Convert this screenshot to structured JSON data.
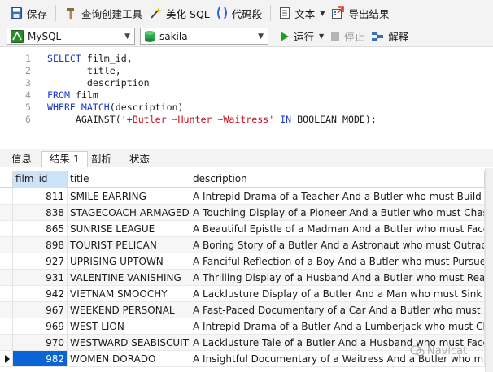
{
  "toolbar": {
    "save": "保存",
    "query_builder": "查询创建工具",
    "beautify": "美化 SQL",
    "snippet": "代码段",
    "text": "文本",
    "export": "导出结果"
  },
  "connection": {
    "server": "MySQL",
    "database": "sakila",
    "run": "运行",
    "stop": "停止",
    "explain": "解释"
  },
  "editor": {
    "lines": [
      {
        "n": "1",
        "parts": [
          {
            "t": "SELECT",
            "c": "kw"
          },
          {
            "t": " film_id,",
            "c": "plain"
          }
        ]
      },
      {
        "n": "2",
        "parts": [
          {
            "t": "       title,",
            "c": "plain"
          }
        ]
      },
      {
        "n": "3",
        "parts": [
          {
            "t": "       description",
            "c": "plain"
          }
        ]
      },
      {
        "n": "4",
        "parts": [
          {
            "t": "FROM",
            "c": "kw"
          },
          {
            "t": " film",
            "c": "plain"
          }
        ]
      },
      {
        "n": "5",
        "parts": [
          {
            "t": "WHERE MATCH",
            "c": "kw"
          },
          {
            "t": "(description)",
            "c": "plain"
          }
        ]
      },
      {
        "n": "6",
        "parts": [
          {
            "t": "     AGAINST(",
            "c": "plain"
          },
          {
            "t": "'+Butler ~Hunter ~Waitress'",
            "c": "str"
          },
          {
            "t": " ",
            "c": "plain"
          },
          {
            "t": "IN",
            "c": "kw"
          },
          {
            "t": " BOOLEAN MODE);",
            "c": "plain"
          }
        ]
      }
    ]
  },
  "tabs": [
    {
      "label": "信息"
    },
    {
      "label": "结果 1"
    },
    {
      "label": "剖析"
    },
    {
      "label": "状态"
    }
  ],
  "grid": {
    "columns": [
      "film_id",
      "title",
      "description"
    ],
    "rows": [
      {
        "film_id": "811",
        "title": "SMILE EARRING",
        "description": "A Intrepid Drama of a Teacher And a Butler who must Build a Pastry"
      },
      {
        "film_id": "838",
        "title": "STAGECOACH ARMAGEDDON",
        "description": "A Touching Display of a Pioneer And a Butler who must Chase a Car"
      },
      {
        "film_id": "865",
        "title": "SUNRISE LEAGUE",
        "description": "A Beautiful Epistle of a Madman And a Butler who must Face a Crocodile"
      },
      {
        "film_id": "898",
        "title": "TOURIST PELICAN",
        "description": "A Boring Story of a Butler And a Astronaut who must Outrace a Pioneer"
      },
      {
        "film_id": "927",
        "title": "UPRISING UPTOWN",
        "description": "A Fanciful Reflection of a Boy And a Butler who must Pursue a Woman"
      },
      {
        "film_id": "931",
        "title": "VALENTINE VANISHING",
        "description": "A Thrilling Display of a Husband And a Butler who must Reach a Pastry"
      },
      {
        "film_id": "942",
        "title": "VIETNAM SMOOCHY",
        "description": "A Lacklusture Display of a Butler And a Man who must Sink a Explorer"
      },
      {
        "film_id": "967",
        "title": "WEEKEND PERSONAL",
        "description": "A Fast-Paced Documentary of a Car And a Butler who must Find a Frisbee"
      },
      {
        "film_id": "969",
        "title": "WEST LION",
        "description": "A Intrepid Drama of a Butler And a Lumberjack who must Challenge"
      },
      {
        "film_id": "970",
        "title": "WESTWARD SEABISCUIT",
        "description": "A Lacklusture Tale of a Butler And a Husband who must Face a Boy in"
      },
      {
        "film_id": "982",
        "title": "WOMEN DORADO",
        "description": "A Insightful Documentary of a Waitress And a Butler who must Vanquish"
      }
    ]
  },
  "watermark": "Navicat",
  "colors": {
    "keyword": "#1f39c8",
    "string": "#c1121f",
    "selection": "#0a64d6",
    "run_green": "#1aa01a"
  }
}
